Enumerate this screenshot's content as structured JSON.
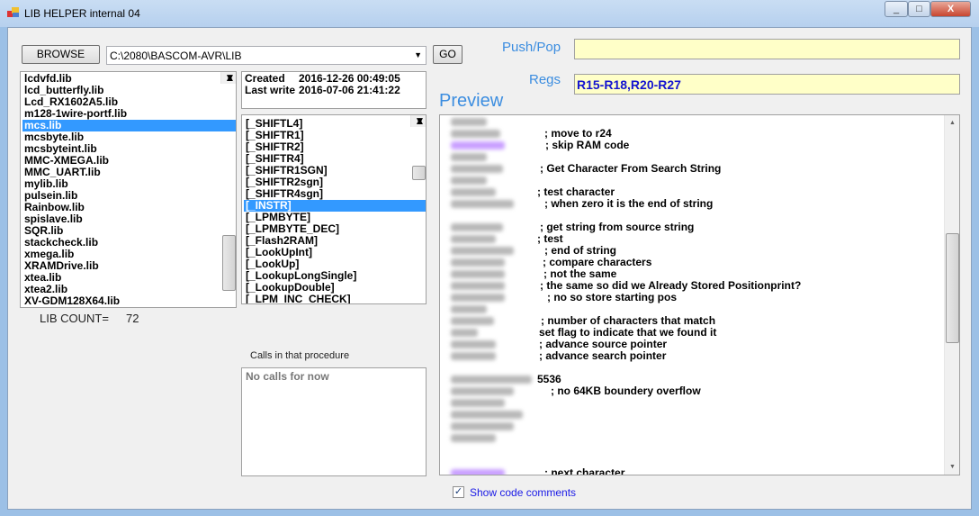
{
  "window": {
    "title": "LIB HELPER internal 04",
    "controls": [
      "_",
      "□",
      "X"
    ]
  },
  "toolbar": {
    "browse_label": "BROWSE",
    "path_value": "C:\\2080\\BASCOM-AVR\\LIB",
    "go_label": "GO"
  },
  "fields": {
    "pushpop_label": "Push/Pop",
    "pushpop_value": "",
    "regs_label": "Regs",
    "regs_value": "R15-R18,R20-R27"
  },
  "preview_label": "Preview",
  "libs": {
    "items": [
      "lcdvfd.lib",
      "lcd_butterfly.lib",
      "Lcd_RX1602A5.lib",
      "m128-1wire-portf.lib",
      "mcs.lib",
      "mcsbyte.lib",
      "mcsbyteint.lib",
      "MMC-XMEGA.lib",
      "MMC_UART.lib",
      "mylib.lib",
      "pulsein.lib",
      "Rainbow.lib",
      "spislave.lib",
      "SQR.lib",
      "stackcheck.lib",
      "xmega.lib",
      "XRAMDrive.lib",
      "xtea.lib",
      "xtea2.lib",
      "XV-GDM128X64.lib"
    ],
    "selected": 4,
    "count_label": "LIB COUNT=",
    "count_value": "72"
  },
  "fileinfo": {
    "created_label": "Created",
    "created_value": "2016-12-26 00:49:05",
    "lastwrite_label": "Last write",
    "lastwrite_value": "2016-07-06 21:41:22"
  },
  "procs": {
    "items": [
      "[_SHIFTL4]",
      "[_SHIFTR1]",
      "[_SHIFTR2]",
      "[_SHIFTR4]",
      "[_SHIFTR1SGN]",
      "[_SHIFTR2sgn]",
      "[_SHIFTR4sgn]",
      "[_INSTR]",
      "[_LPMBYTE]",
      "[_LPMBYTE_DEC]",
      "[_Flash2RAM]",
      "[_LookUpInt]",
      "[_LookUp]",
      "[_LookupLongSingle]",
      "[_LookupDouble]",
      "[_LPM_INC_CHECK]"
    ],
    "selected": 7
  },
  "calls": {
    "label": "Calls in that procedure",
    "text": "No calls for now"
  },
  "code": [
    {
      "c": ""
    },
    {
      "c": "; move to r24"
    },
    {
      "c": "; skip RAM code",
      "purple": true
    },
    {
      "c": ""
    },
    {
      "c": "; Get Character From Search String"
    },
    {
      "c": ""
    },
    {
      "c": "; test character"
    },
    {
      "c": "; when zero it is the end of string"
    },
    {
      "c": "",
      "empty": true
    },
    {
      "c": "; get string from source string"
    },
    {
      "c": "; test"
    },
    {
      "c": "; end of string"
    },
    {
      "c": "; compare characters"
    },
    {
      "c": "; not the same"
    },
    {
      "c": "; the same so did we Already Stored Positionprint?"
    },
    {
      "c": "; no so store starting pos"
    },
    {
      "c": ""
    },
    {
      "c": "; number of characters that match"
    },
    {
      "c": "set flag to indicate that we found it"
    },
    {
      "c": "; advance source pointer"
    },
    {
      "c": "; advance search pointer"
    },
    {
      "c": "",
      "empty": true
    },
    {
      "c": "5536"
    },
    {
      "c": "; no 64KB boundery overflow"
    },
    {
      "c": ""
    },
    {
      "c": ""
    },
    {
      "c": ""
    },
    {
      "c": ""
    },
    {
      "c": "",
      "empty": true
    },
    {
      "c": "",
      "empty": true
    },
    {
      "c": "; next character",
      "purple": true
    }
  ],
  "show_comments": {
    "label": "Show code comments",
    "checked": true
  }
}
